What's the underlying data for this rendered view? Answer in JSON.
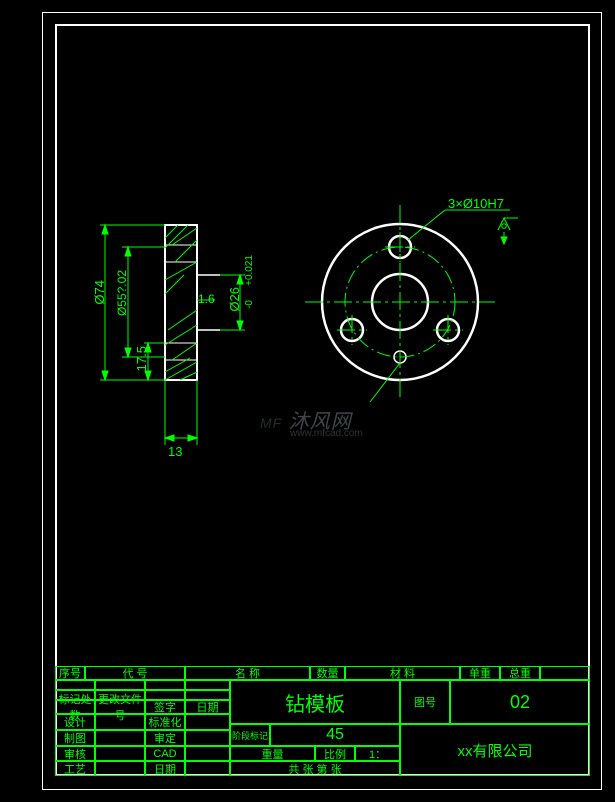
{
  "dimensions": {
    "outer_dia": "Ø74",
    "bolt_circle": "Ø55?.02",
    "offset": "17.5",
    "thickness": "13",
    "chamfer": "1.6",
    "bore_dia": "Ø26",
    "bore_tol_upper": "+0.021",
    "bore_tol_lower": "-0",
    "hole_callout": "3×Ø10H7"
  },
  "surface_symbol": "▽",
  "title_block": {
    "part_name": "钻模板",
    "material": "45",
    "drawing_no_label": "图号",
    "drawing_no": "02",
    "scale_label": "比例",
    "scale": "1：",
    "company": "xx有限公司",
    "headers": {
      "col1": "序号",
      "col2": "代    号",
      "col3": "名    称",
      "col4": "数量",
      "col5": "材    料",
      "col6": "单重",
      "col7": "总重"
    },
    "rows": {
      "r1a": "标记处数",
      "r1b": "更改文件号",
      "r1c": "签字",
      "r1d": "日期",
      "design": "设计",
      "std": "标准化",
      "draw": "制图",
      "check": "审定",
      "approve": "审核",
      "cad": "CAD",
      "process": "工艺",
      "date": "日期",
      "weight": "重量",
      "mat_code": "阶段标记",
      "sheet": "共    张   第    张"
    }
  },
  "watermark": "沐风网",
  "watermark_url": "www.mfcad.com"
}
